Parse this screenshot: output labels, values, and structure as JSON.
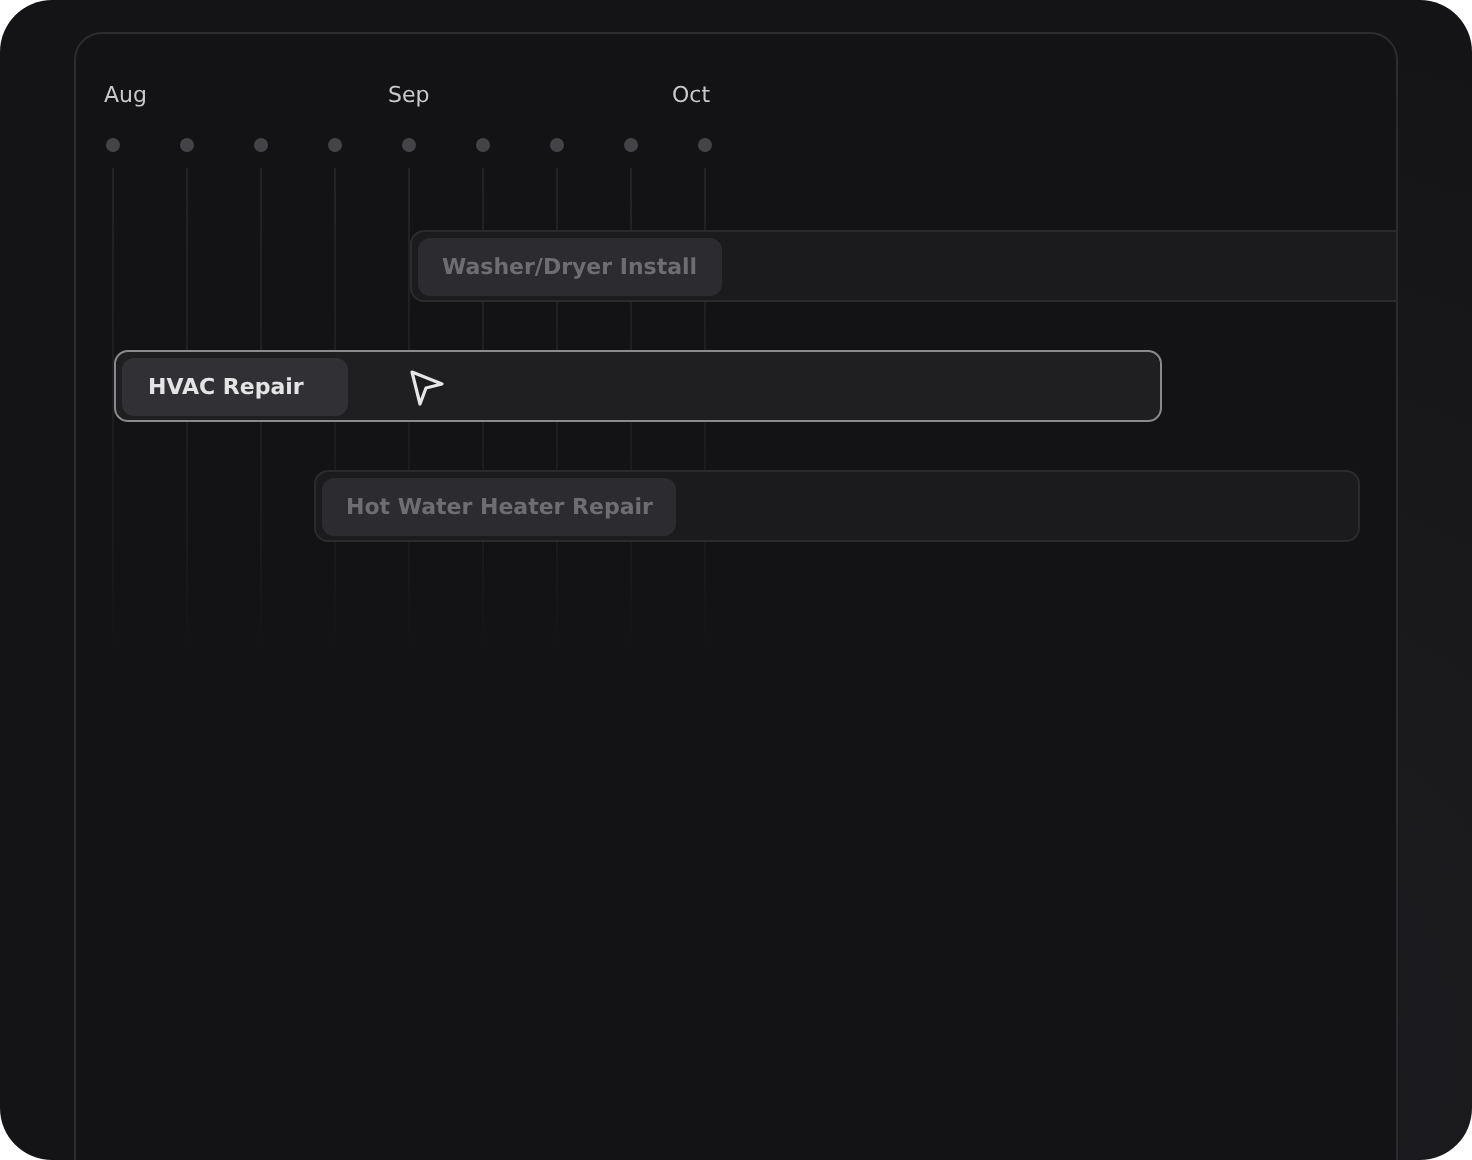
{
  "months": [
    "Aug",
    "Sep",
    "Oct"
  ],
  "tasks": [
    {
      "label": "Washer/Dryer Install",
      "selected": false
    },
    {
      "label": "HVAC Repair",
      "selected": true
    },
    {
      "label": "Hot Water Heater Repair",
      "selected": false
    }
  ]
}
